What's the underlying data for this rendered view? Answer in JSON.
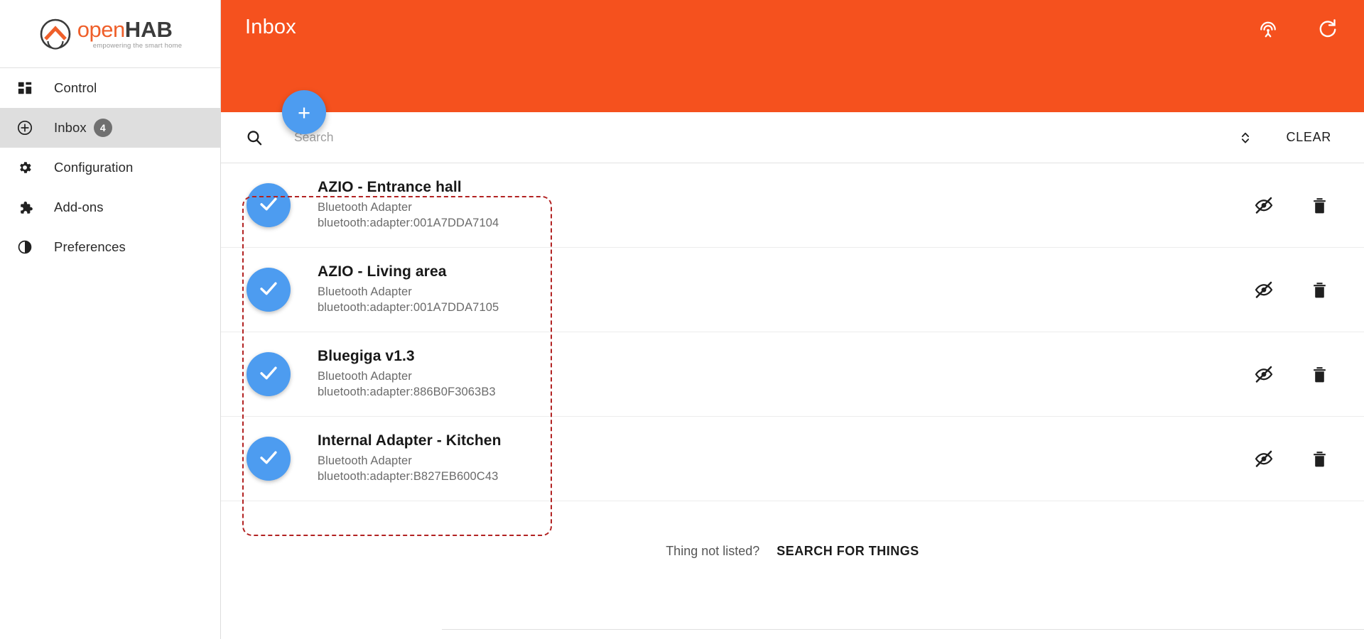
{
  "brand": {
    "name_part1": "open",
    "name_part2": "HAB",
    "tagline": "empowering the smart home",
    "logo_icon": "openhab-logo-icon",
    "accent_color": "#ef5f2a"
  },
  "sidebar": {
    "items": [
      {
        "label": "Control",
        "icon": "dashboard-icon",
        "active": false,
        "badge": ""
      },
      {
        "label": "Inbox",
        "icon": "plus-circle-icon",
        "active": true,
        "badge": "4"
      },
      {
        "label": "Configuration",
        "icon": "gear-icon",
        "active": false,
        "badge": ""
      },
      {
        "label": "Add-ons",
        "icon": "puzzle-piece-icon",
        "active": false,
        "badge": ""
      },
      {
        "label": "Preferences",
        "icon": "contrast-icon",
        "active": false,
        "badge": ""
      }
    ]
  },
  "header": {
    "title": "Inbox",
    "background_color": "#F5511E",
    "scan_icon": "broadcast-scan-icon",
    "refresh_icon": "refresh-icon",
    "fab_label": "+",
    "fab_color": "#4d9cf0"
  },
  "search": {
    "placeholder": "Search",
    "value": "",
    "icon": "search-icon",
    "sort_icon": "unfold-sort-icon",
    "clear_label": "CLEAR"
  },
  "inbox": {
    "subtitle_type": "Bluetooth Adapter",
    "hide_icon": "eye-off-icon",
    "delete_icon": "trash-icon",
    "check_icon": "check-icon",
    "items": [
      {
        "title": "AZIO - Entrance hall",
        "type": "Bluetooth Adapter",
        "uid": "bluetooth:adapter:001A7DDA7104"
      },
      {
        "title": "AZIO - Living area",
        "type": "Bluetooth Adapter",
        "uid": "bluetooth:adapter:001A7DDA7105"
      },
      {
        "title": "Bluegiga v1.3",
        "type": "Bluetooth Adapter",
        "uid": "bluetooth:adapter:886B0F3063B3"
      },
      {
        "title": "Internal Adapter - Kitchen",
        "type": "Bluetooth Adapter",
        "uid": "bluetooth:adapter:B827EB600C43"
      }
    ]
  },
  "footer": {
    "text": "Thing not listed?",
    "button_label": "SEARCH FOR THINGS"
  },
  "annotation": {
    "color": "#b22222",
    "style": "dashed-rounded-rectangle"
  }
}
